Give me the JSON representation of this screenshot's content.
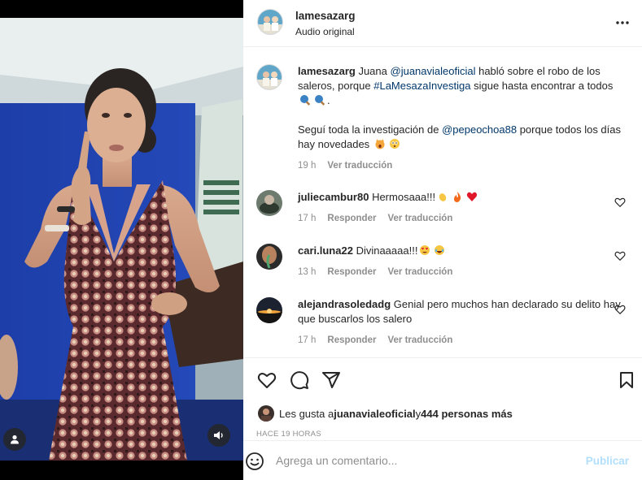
{
  "header": {
    "username": "lamesazarg",
    "audio": "Audio original",
    "more_icon": "more-horizontal-icon"
  },
  "caption": {
    "username": "lamesazarg",
    "text_1": "Juana ",
    "mention_1": "@juanavialeoficial",
    "text_2": " habló sobre el robo de los saleros, porque ",
    "hashtag": "#LaMesazaInvestiga",
    "text_3": " sigue hasta encontrar a todos ",
    "text_4": ".",
    "text_5": "Seguí toda la investigación de ",
    "mention_2": "@pepeochoa88",
    "text_6": " porque todos los días hay novedades ",
    "time": "19 h",
    "translate": "Ver traducción"
  },
  "comments": [
    {
      "username": "juliecambur80",
      "text": "Hermosaaa!!!",
      "time": "17 h",
      "reply": "Responder",
      "translate": "Ver traducción"
    },
    {
      "username": "cari.luna22",
      "text": "Divinaaaaa!!!",
      "time": "13 h",
      "reply": "Responder",
      "translate": "Ver traducción"
    },
    {
      "username": "alejandrasoledadg",
      "text": "Genial pero muchos han declarado su delito hay que buscarlos los salero",
      "time": "17 h",
      "reply": "Responder",
      "translate": "Ver traducción"
    }
  ],
  "likes": {
    "prefix": "Les gusta a ",
    "user": "juanavialeoficial",
    "middle": " y ",
    "others": "444 personas más"
  },
  "time_ago": "HACE 19 HORAS",
  "comment_box": {
    "placeholder": "Agrega un comentario...",
    "publish": "Publicar"
  },
  "colors": {
    "mention": "#00376b",
    "muted": "#8e8e8e",
    "publish_disabled": "#b2dffc",
    "media_bg": "#1f3f9e"
  }
}
